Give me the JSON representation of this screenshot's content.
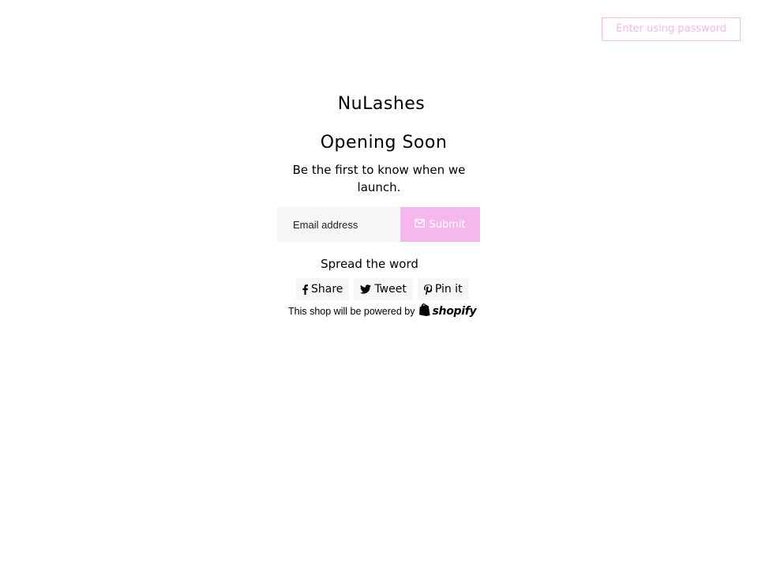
{
  "header": {
    "password_button_label": "Enter using password"
  },
  "main": {
    "shop_name": "NuLashes",
    "headline": "Opening Soon",
    "subtext": "Be the first to know when we launch."
  },
  "signup": {
    "email_placeholder": "Email address",
    "submit_label": "Submit",
    "submit_icon": "envelope-icon"
  },
  "share": {
    "heading": "Spread the word",
    "buttons": [
      {
        "label": "Share",
        "icon": "facebook-icon"
      },
      {
        "label": "Tweet",
        "icon": "twitter-icon"
      },
      {
        "label": "Pin it",
        "icon": "pinterest-icon"
      }
    ]
  },
  "footer": {
    "powered_by_text": "This shop will be powered by",
    "brand": "shopify",
    "brand_icon": "shopify-bag-icon"
  },
  "colors": {
    "accent": "#f5b7ee",
    "field_bg": "#f6f6f6",
    "text": "#000000",
    "background": "#ffffff"
  }
}
